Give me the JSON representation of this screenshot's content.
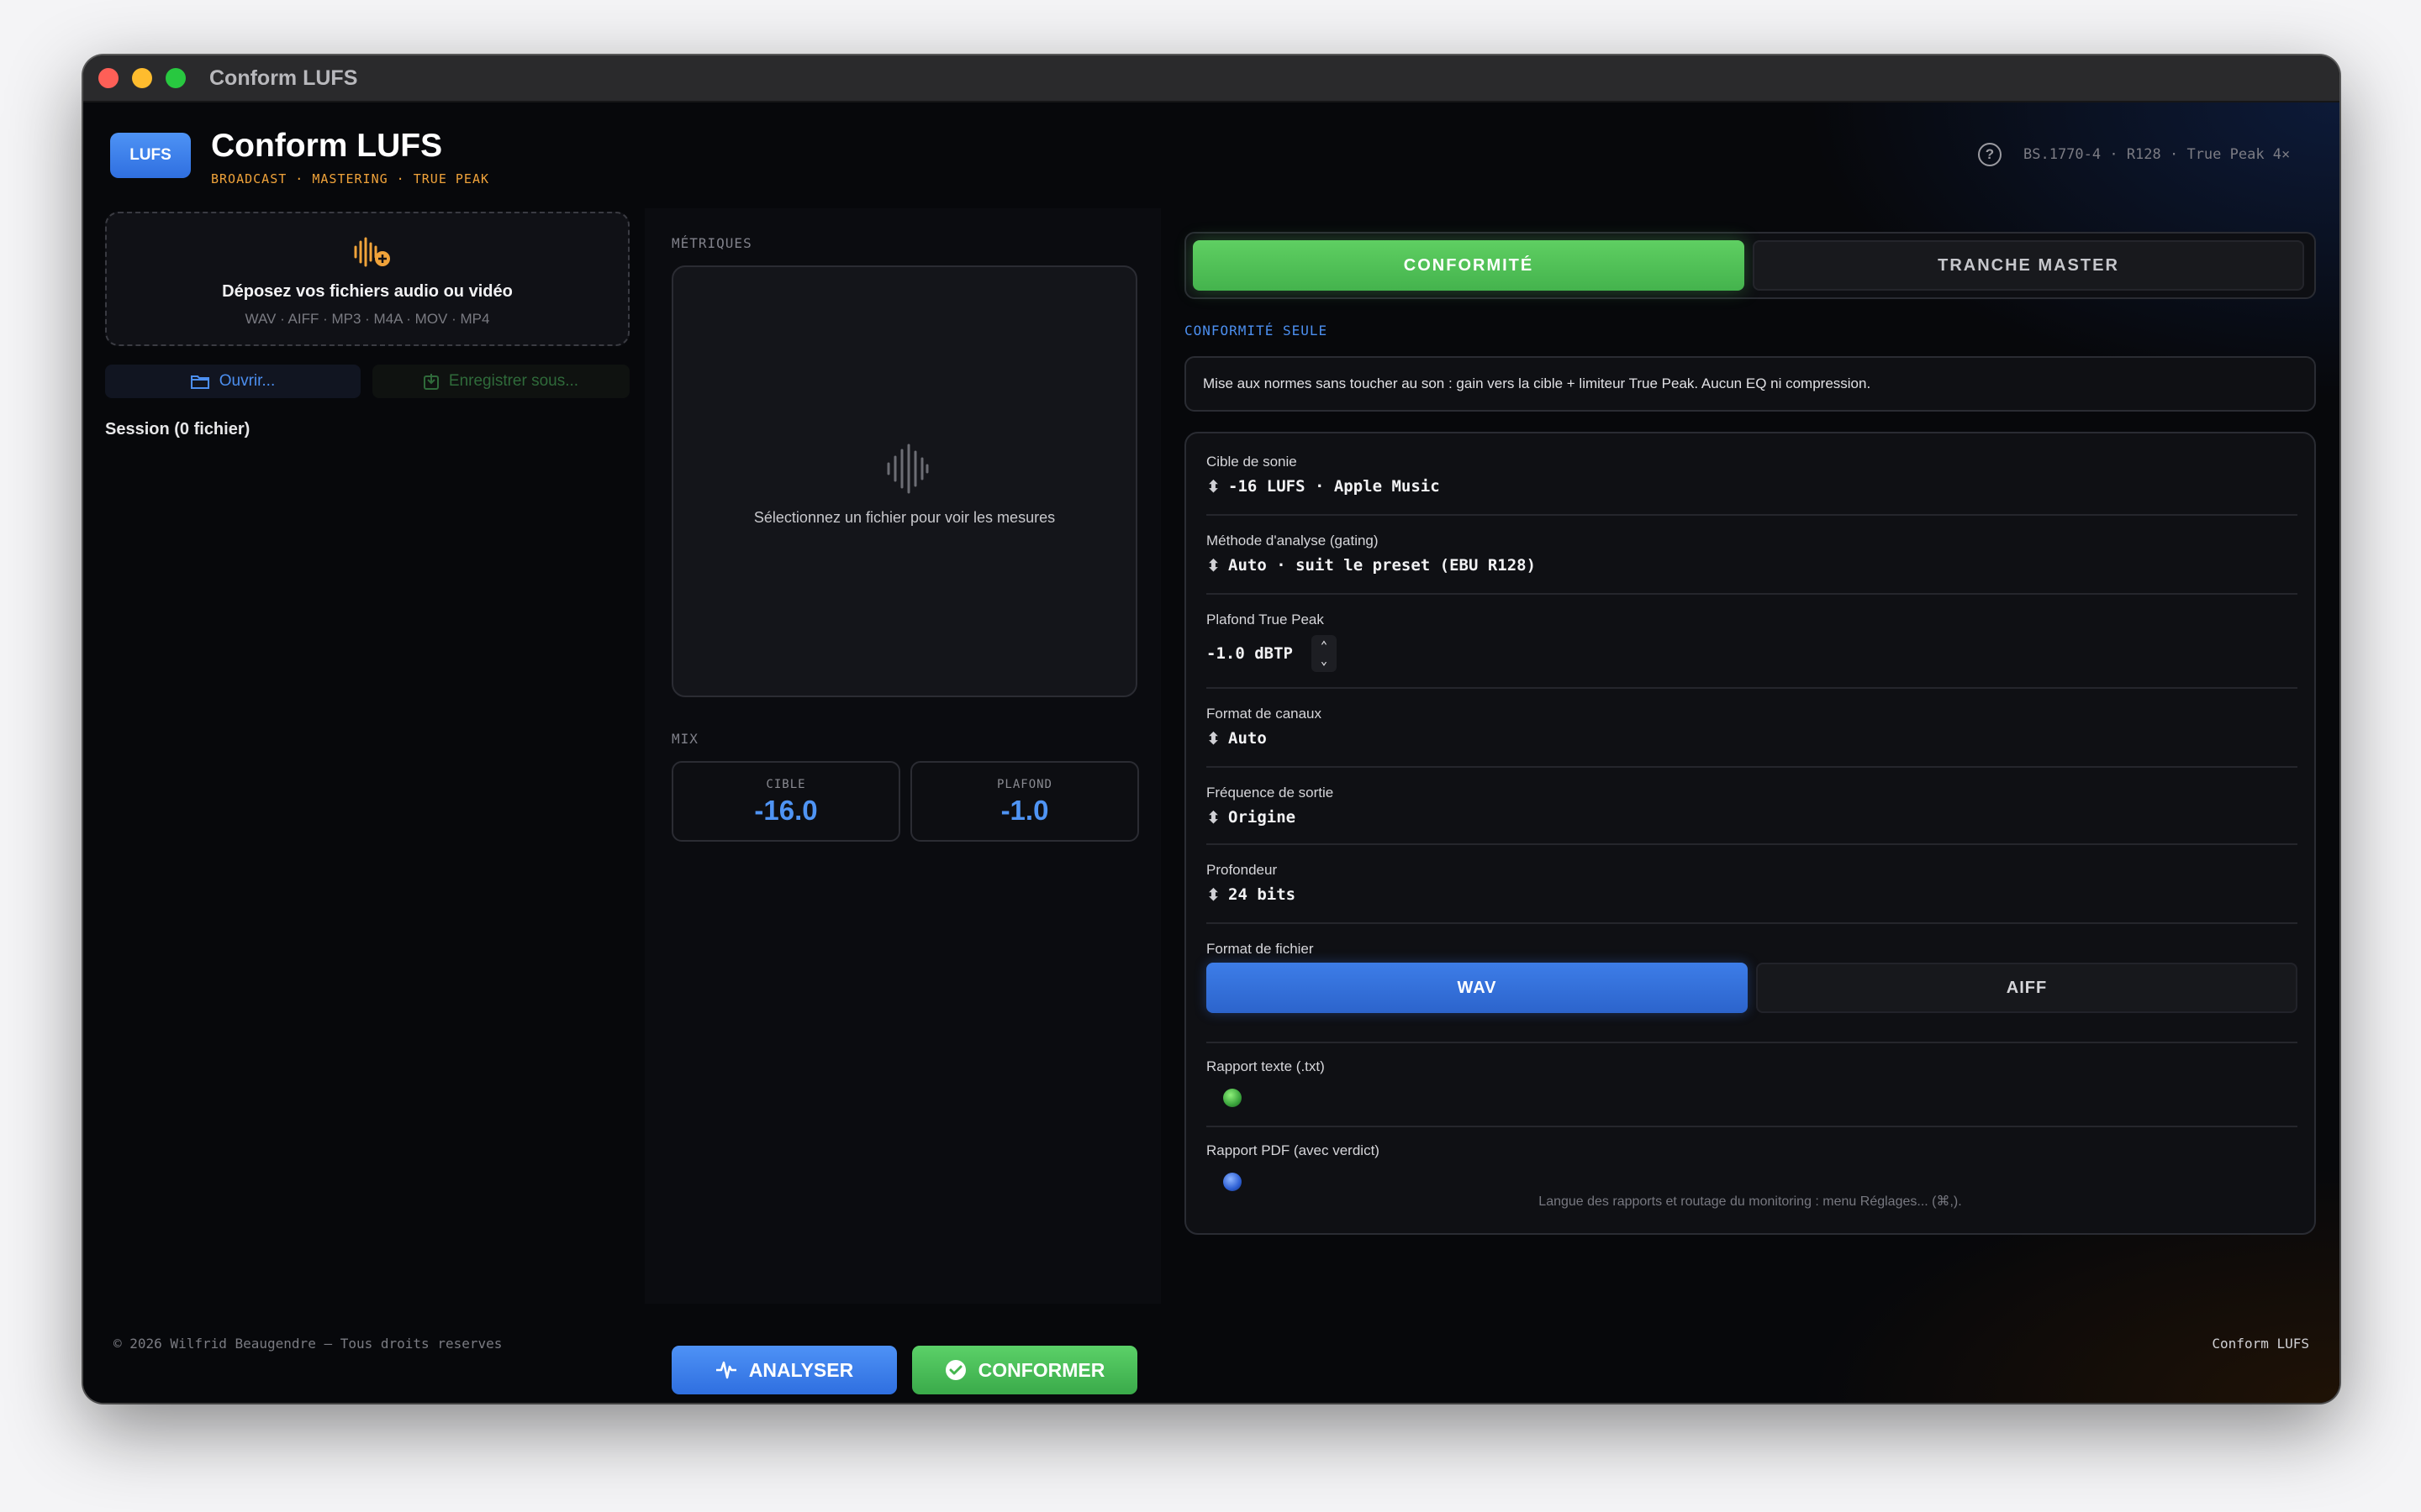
{
  "window": {
    "title": "Conform LUFS"
  },
  "header": {
    "badge": "LUFS",
    "title": "Conform LUFS",
    "subtitle": "BROADCAST · MASTERING · TRUE PEAK",
    "help_glyph": "?",
    "standards": "BS.1770-4 · R128 · True Peak 4×"
  },
  "left": {
    "drop_title": "Déposez vos fichiers audio ou vidéo",
    "drop_formats": "WAV · AIFF · MP3 · M4A · MOV · MP4",
    "open_label": "Ouvrir...",
    "save_label": "Enregistrer sous...",
    "session_label": "Session (0 fichier)"
  },
  "middle": {
    "metrics_label": "MÉTRIQUES",
    "metrics_empty": "Sélectionnez un fichier pour voir les mesures",
    "mix_label": "MIX",
    "target_label": "CIBLE",
    "target_value": "-16.0",
    "ceiling_label": "PLAFOND",
    "ceiling_value": "-1.0",
    "analyse_label": "ANALYSER",
    "conform_label": "CONFORMER"
  },
  "right": {
    "mode_active": "CONFORMITÉ",
    "mode_inactive": "TRANCHE MASTER",
    "mode_caption": "CONFORMITÉ SEULE",
    "info_text": "Mise aux normes sans toucher au son : gain vers la cible + limiteur True Peak. Aucun EQ ni compression.",
    "settings": {
      "loudness_label": "Cible de sonie",
      "loudness_value": "-16 LUFS · Apple Music",
      "gating_label": "Méthode d'analyse (gating)",
      "gating_value": "Auto · suit le preset (EBU R128)",
      "truepeak_label": "Plafond True Peak",
      "truepeak_value": "-1.0 dBTP",
      "channels_label": "Format de canaux",
      "channels_value": "Auto",
      "samplerate_label": "Fréquence de sortie",
      "samplerate_value": "Origine",
      "bitdepth_label": "Profondeur",
      "bitdepth_value": "24 bits",
      "fileformat_label": "Format de fichier",
      "format_wav": "WAV",
      "format_aiff": "AIFF",
      "report_txt_label": "Rapport texte (.txt)",
      "report_pdf_label": "Rapport PDF (avec verdict)",
      "footnote": "Langue des rapports et routage du monitoring : menu Réglages... (⌘,)."
    }
  },
  "footer": {
    "copyright": "© 2026 Wilfrid Beaugendre — Tous droits reserves",
    "brand": "Conform LUFS"
  },
  "colors": {
    "accent_blue": "#4c8ff0",
    "accent_green": "#4fbf55",
    "accent_orange": "#f0a33a",
    "background": "#07080b"
  },
  "icons": {
    "drop": "waveform-plus-icon",
    "open": "folder-icon",
    "save": "save-icon",
    "metrics_empty": "waveform-icon",
    "analyse": "waveform-pulse-icon",
    "conform": "checkmark-seal-icon",
    "help": "question-circle-icon",
    "selector": "chevron-up-down-icon",
    "stepper": "stepper-icon"
  }
}
